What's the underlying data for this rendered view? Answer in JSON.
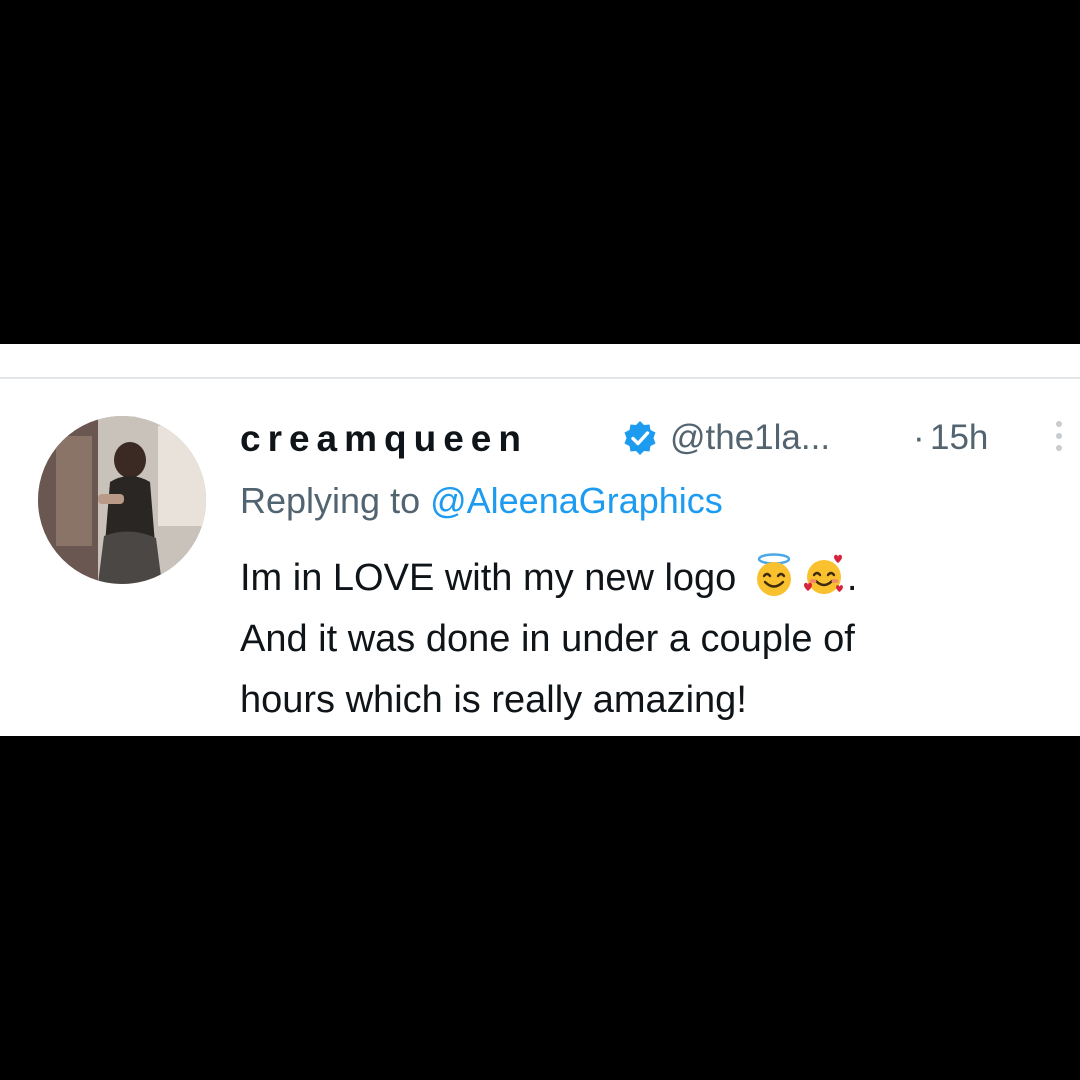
{
  "tweet": {
    "display_name": "creamqueen",
    "handle": "@the1la...",
    "separator": "·",
    "timestamp": "15h",
    "replying_prefix": "Replying to ",
    "replying_to": "@AleenaGraphics",
    "text_line1": "Im in LOVE with my new logo",
    "text_after_emoji": ".",
    "text_line2": "And it was done in under a couple of",
    "text_line3": "hours which is really amazing!",
    "emojis": [
      "smiling-face-with-halo-icon",
      "smiling-face-with-hearts-icon"
    ]
  },
  "icons": {
    "verified": "verified-badge-icon",
    "more": "more-options-icon"
  },
  "colors": {
    "background": "#000000",
    "card": "#ffffff",
    "text": "#0f1419",
    "secondary": "#536471",
    "accent": "#1d9bf0"
  }
}
